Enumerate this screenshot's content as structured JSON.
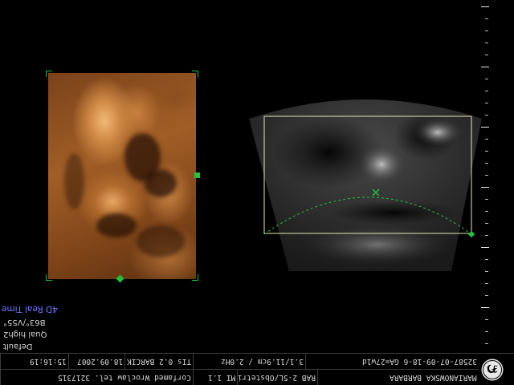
{
  "settings": {
    "mode": "4D Real Time",
    "angle": "B63°/V55°",
    "quality": "Qual high2",
    "preset": "Default"
  },
  "info": {
    "patient": "MARIANOWSKA BARBARA",
    "exam_id": "32587-07-09-18-6 GA=27w1d",
    "probe": "RAB 2-5L/Obstetric",
    "acquisition": "3.1/11.9cm / 2.0Hz",
    "institution": "Corfamed Wroclaw tel. 3217315",
    "mi": "MI 1.1",
    "tis": "TIs 0.2 BARCIK",
    "date": "18.09.2007",
    "time": "15:16:19"
  },
  "icons": {
    "logo": "ge-logo-icon",
    "cursor": "x-cursor-icon"
  },
  "colors": {
    "overlay_green": "#1fc33a",
    "roi_box": "#e6e6b4",
    "mode_text": "#6f7bff",
    "render_tone": "#c8803e"
  }
}
